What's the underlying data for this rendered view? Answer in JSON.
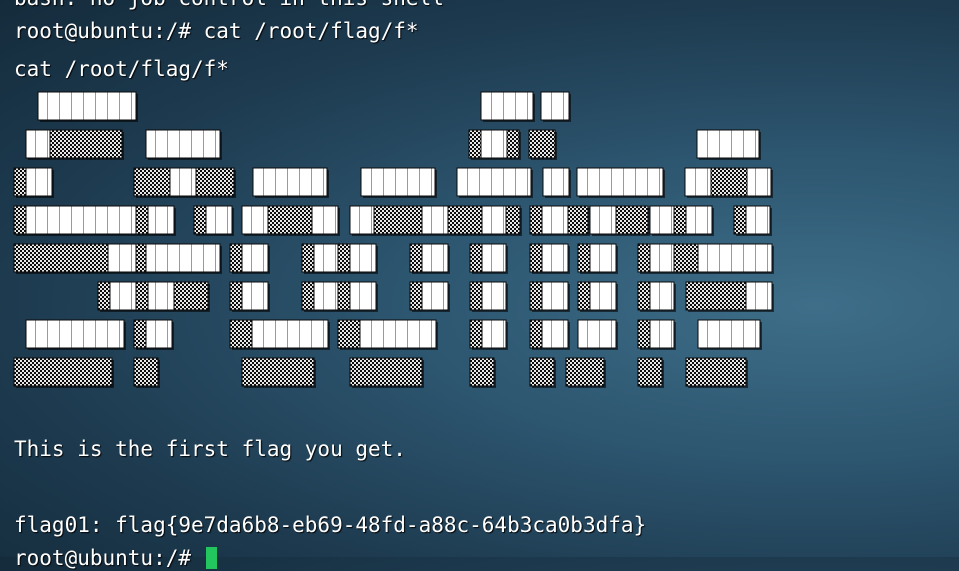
{
  "terminal": {
    "lines": {
      "warning": "bash: no job control in this shell",
      "command": "root@ubuntu:/# cat /root/flag/f*",
      "echo": "cat /root/flag/f*",
      "message": "This is the first flag you get.",
      "flag": "flag01: flag{9e7da6b8-eb69-48fd-a88c-64b3ca0b3dfa}",
      "prompt": "root@ubuntu:/# "
    },
    "colors": {
      "background": "#1d3a4f",
      "text": "#ffffff",
      "cursor": "#22c55e"
    }
  }
}
